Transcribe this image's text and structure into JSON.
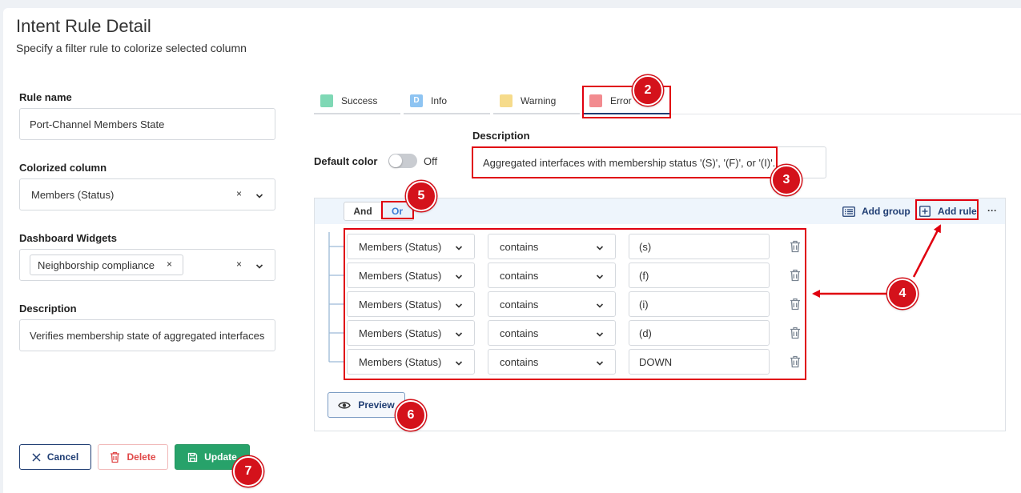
{
  "header": {
    "title": "Intent Rule Detail",
    "subtitle": "Specify a filter rule to colorize selected column"
  },
  "form": {
    "rule_name_label": "Rule name",
    "rule_name_value": "Port-Channel Members State",
    "colorized_column_label": "Colorized column",
    "colorized_column_value": "Members (Status)",
    "dashboard_widgets_label": "Dashboard Widgets",
    "dashboard_widgets_chip": "Neighborship compliance",
    "description_label": "Description",
    "description_value": "Verifies membership state of aggregated interfaces",
    "clear_symbol": "×",
    "chip_remove_symbol": "×"
  },
  "footer": {
    "cancel_label": "Cancel",
    "delete_label": "Delete",
    "update_label": "Update"
  },
  "tabs": [
    {
      "label": "Success",
      "color": "#7fd8b5"
    },
    {
      "label": "Info",
      "color": "#8ec4f2",
      "glyph": "D"
    },
    {
      "label": "Warning",
      "color": "#f6db8b"
    },
    {
      "label": "Error",
      "color": "#f28b8f"
    }
  ],
  "rule_panel": {
    "default_color_label": "Default color",
    "toggle_state": "Off",
    "description_label": "Description",
    "description_value": "Aggregated interfaces with membership status '(S)', '(F)', or '(I)'.",
    "and_label": "And",
    "or_label": "Or",
    "add_group_label": "Add group",
    "add_rule_label": "Add rule",
    "more_symbol": "···",
    "preview_label": "Preview",
    "rules": [
      {
        "field": "Members (Status)",
        "operator": "contains",
        "value": "(s)"
      },
      {
        "field": "Members (Status)",
        "operator": "contains",
        "value": "(f)"
      },
      {
        "field": "Members (Status)",
        "operator": "contains",
        "value": "(i)"
      },
      {
        "field": "Members (Status)",
        "operator": "contains",
        "value": "(d)"
      },
      {
        "field": "Members (Status)",
        "operator": "contains",
        "value": "DOWN"
      }
    ]
  },
  "annotations": {
    "b2": "2",
    "b3": "3",
    "b4": "4",
    "b5": "5",
    "b6": "6",
    "b7": "7"
  },
  "colors": {
    "accent": "#1f3d73",
    "success": "#27a26a",
    "danger": "#e04848",
    "annotation": "#d4121b"
  }
}
